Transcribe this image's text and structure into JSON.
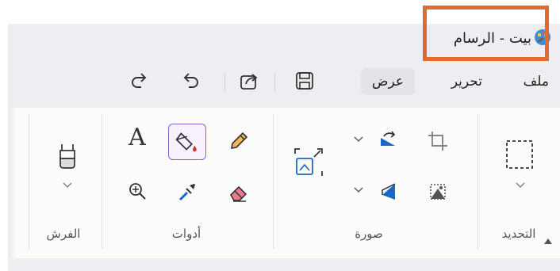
{
  "window": {
    "title": "بيت - الرسام",
    "icon": "paint-palette-icon"
  },
  "menu": {
    "file": "ملف",
    "edit": "تحرير",
    "view": "عرض"
  },
  "quick_access": {
    "save": "save-icon",
    "share": "share-icon",
    "undo": "undo-icon",
    "redo": "redo-icon"
  },
  "groups": {
    "selection": "التحديد",
    "image": "صورة",
    "tools": "أدوات",
    "brushes": "الفرش"
  },
  "tools": {
    "text_glyph": "A"
  },
  "colors": {
    "highlight_border": "#e36a2a",
    "selected_tool_border": "#8a62c6",
    "fill_drop": "#c8342a",
    "pencil_fill": "#f0b25a",
    "eraser_fill": "#e87b8c"
  }
}
